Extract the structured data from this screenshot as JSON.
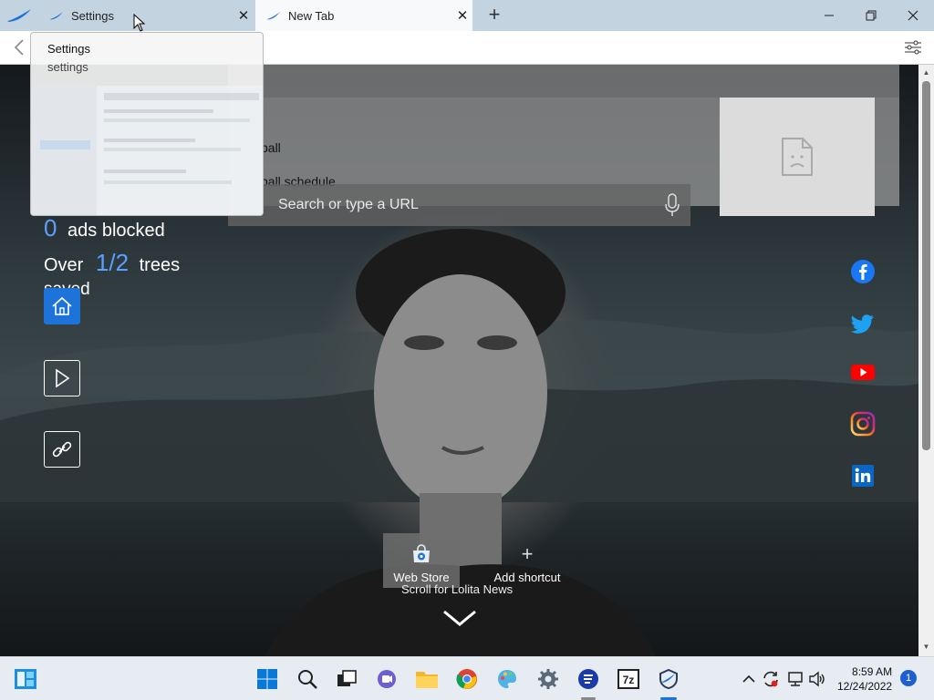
{
  "tabs": [
    {
      "title": "Settings",
      "close": "✕"
    },
    {
      "title": "New Tab",
      "close": "✕"
    }
  ],
  "newtab_button": "+",
  "window_controls": {
    "minimize": "─",
    "maximize": "☐",
    "close": "✕"
  },
  "preview": {
    "title": "Settings",
    "subtitle": "settings"
  },
  "suggestions": [
    "ball",
    "ball schedule"
  ],
  "search": {
    "placeholder": "Search or type a URL"
  },
  "stats": {
    "ads_value": "0",
    "ads_label": "ads blocked",
    "trees_prefix": "Over",
    "trees_value": "1/2",
    "trees_label": "trees",
    "trees_suffix": "saved"
  },
  "shortcuts": [
    {
      "label": "Web Store"
    },
    {
      "label": "Add shortcut",
      "icon": "+"
    }
  ],
  "news": {
    "label": "Scroll for Lolita News"
  },
  "social": [
    "facebook-icon",
    "twitter-icon",
    "youtube-icon",
    "instagram-icon",
    "linkedin-icon"
  ],
  "taskbar": {
    "time": "8:59 AM",
    "date": "12/24/2022",
    "notifications": "1"
  },
  "colors": {
    "accent": "#1e73d8",
    "stat_number": "#5aa0ff"
  }
}
